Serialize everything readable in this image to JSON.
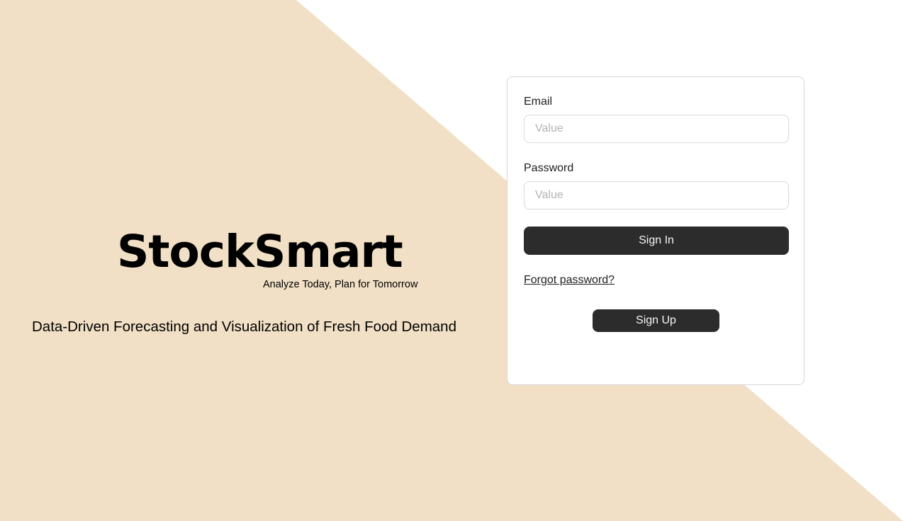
{
  "colors": {
    "background_left": "#f1e0c5",
    "background_right": "#ffffff",
    "button": "#2c2c2c",
    "button_text": "#f5f5f5",
    "input_border": "#d9d9d9",
    "card_border": "#d6d6d6"
  },
  "brand": {
    "title": "StockSmart",
    "tagline": "Analyze Today, Plan for Tomorrow",
    "headline": "Data-Driven  Forecasting and Visualization of Fresh Food Demand"
  },
  "login": {
    "email_label": "Email",
    "email_placeholder": "Value",
    "password_label": "Password",
    "password_placeholder": "Value",
    "signin_label": "Sign In",
    "forgot_label": "Forgot password?",
    "signup_label": "Sign Up"
  }
}
